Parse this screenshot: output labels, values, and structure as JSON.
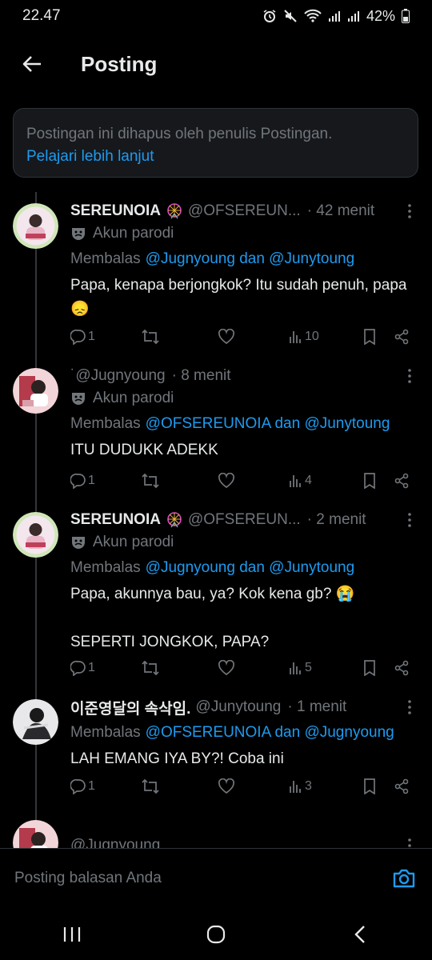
{
  "status_bar": {
    "time": "22.47",
    "battery": "42%"
  },
  "header": {
    "title": "Posting"
  },
  "notice": {
    "text": "Postingan ini dihapus oleh penulis Postingan.",
    "link": "Pelajari lebih lanjut"
  },
  "tweets": [
    {
      "display_name": "SEREUNOIA",
      "handle": "@OFSEREUN...",
      "time": "· 42 menit",
      "parody": "Akun parodi",
      "reply_prefix": "Membalas",
      "reply_to": "@Jugnyoung dan @Junytoung",
      "text": "Papa, kenapa berjongkok? Itu sudah penuh, papa 😞",
      "counts": {
        "reply": "1",
        "repost": "",
        "like": "",
        "views": "10"
      }
    },
    {
      "display_name": "",
      "handle": "˙@Jugnyoung",
      "time": "· 8 menit",
      "parody": "Akun parodi",
      "reply_prefix": "Membalas",
      "reply_to": "@OFSEREUNOIA dan @Junytoung",
      "text": "ITU DUDUKK ADEKK",
      "counts": {
        "reply": "1",
        "repost": "",
        "like": "",
        "views": "4"
      }
    },
    {
      "display_name": "SEREUNOIA",
      "handle": "@OFSEREUN...",
      "time": "· 2 menit",
      "parody": "Akun parodi",
      "reply_prefix": "Membalas",
      "reply_to": "@Jugnyoung dan @Junytoung",
      "text": "Papa, akunnya bau, ya? Kok kena gb? 😭\n\nSEPERTI JONGKOK, PAPA?",
      "counts": {
        "reply": "1",
        "repost": "",
        "like": "",
        "views": "5"
      }
    },
    {
      "display_name": "이준영달의 속삭임.",
      "handle": "@Junytoung",
      "time": "· 1 menit",
      "parody": "",
      "reply_prefix": "Membalas",
      "reply_to": "@OFSEREUNOIA dan @Jugnyoung",
      "text": "LAH EMANG IYA BY?! Coba ini",
      "counts": {
        "reply": "1",
        "repost": "",
        "like": "",
        "views": "3"
      }
    },
    {
      "display_name": "",
      "handle": "@Jugnyoung",
      "time": "",
      "parody": "",
      "reply_prefix": "",
      "reply_to": "",
      "text": "",
      "counts": {}
    }
  ],
  "compose": {
    "placeholder": "Posting balasan Anda"
  },
  "colors": {
    "accent": "#1d9bf0",
    "muted": "#71767b",
    "background": "#000000"
  },
  "icons": [
    "back-arrow-icon",
    "more-icon",
    "parody-mask-icon",
    "reply-icon",
    "repost-icon",
    "like-icon",
    "views-icon",
    "bookmark-icon",
    "share-icon",
    "camera-icon",
    "recents-icon",
    "home-icon",
    "back-nav-icon"
  ]
}
